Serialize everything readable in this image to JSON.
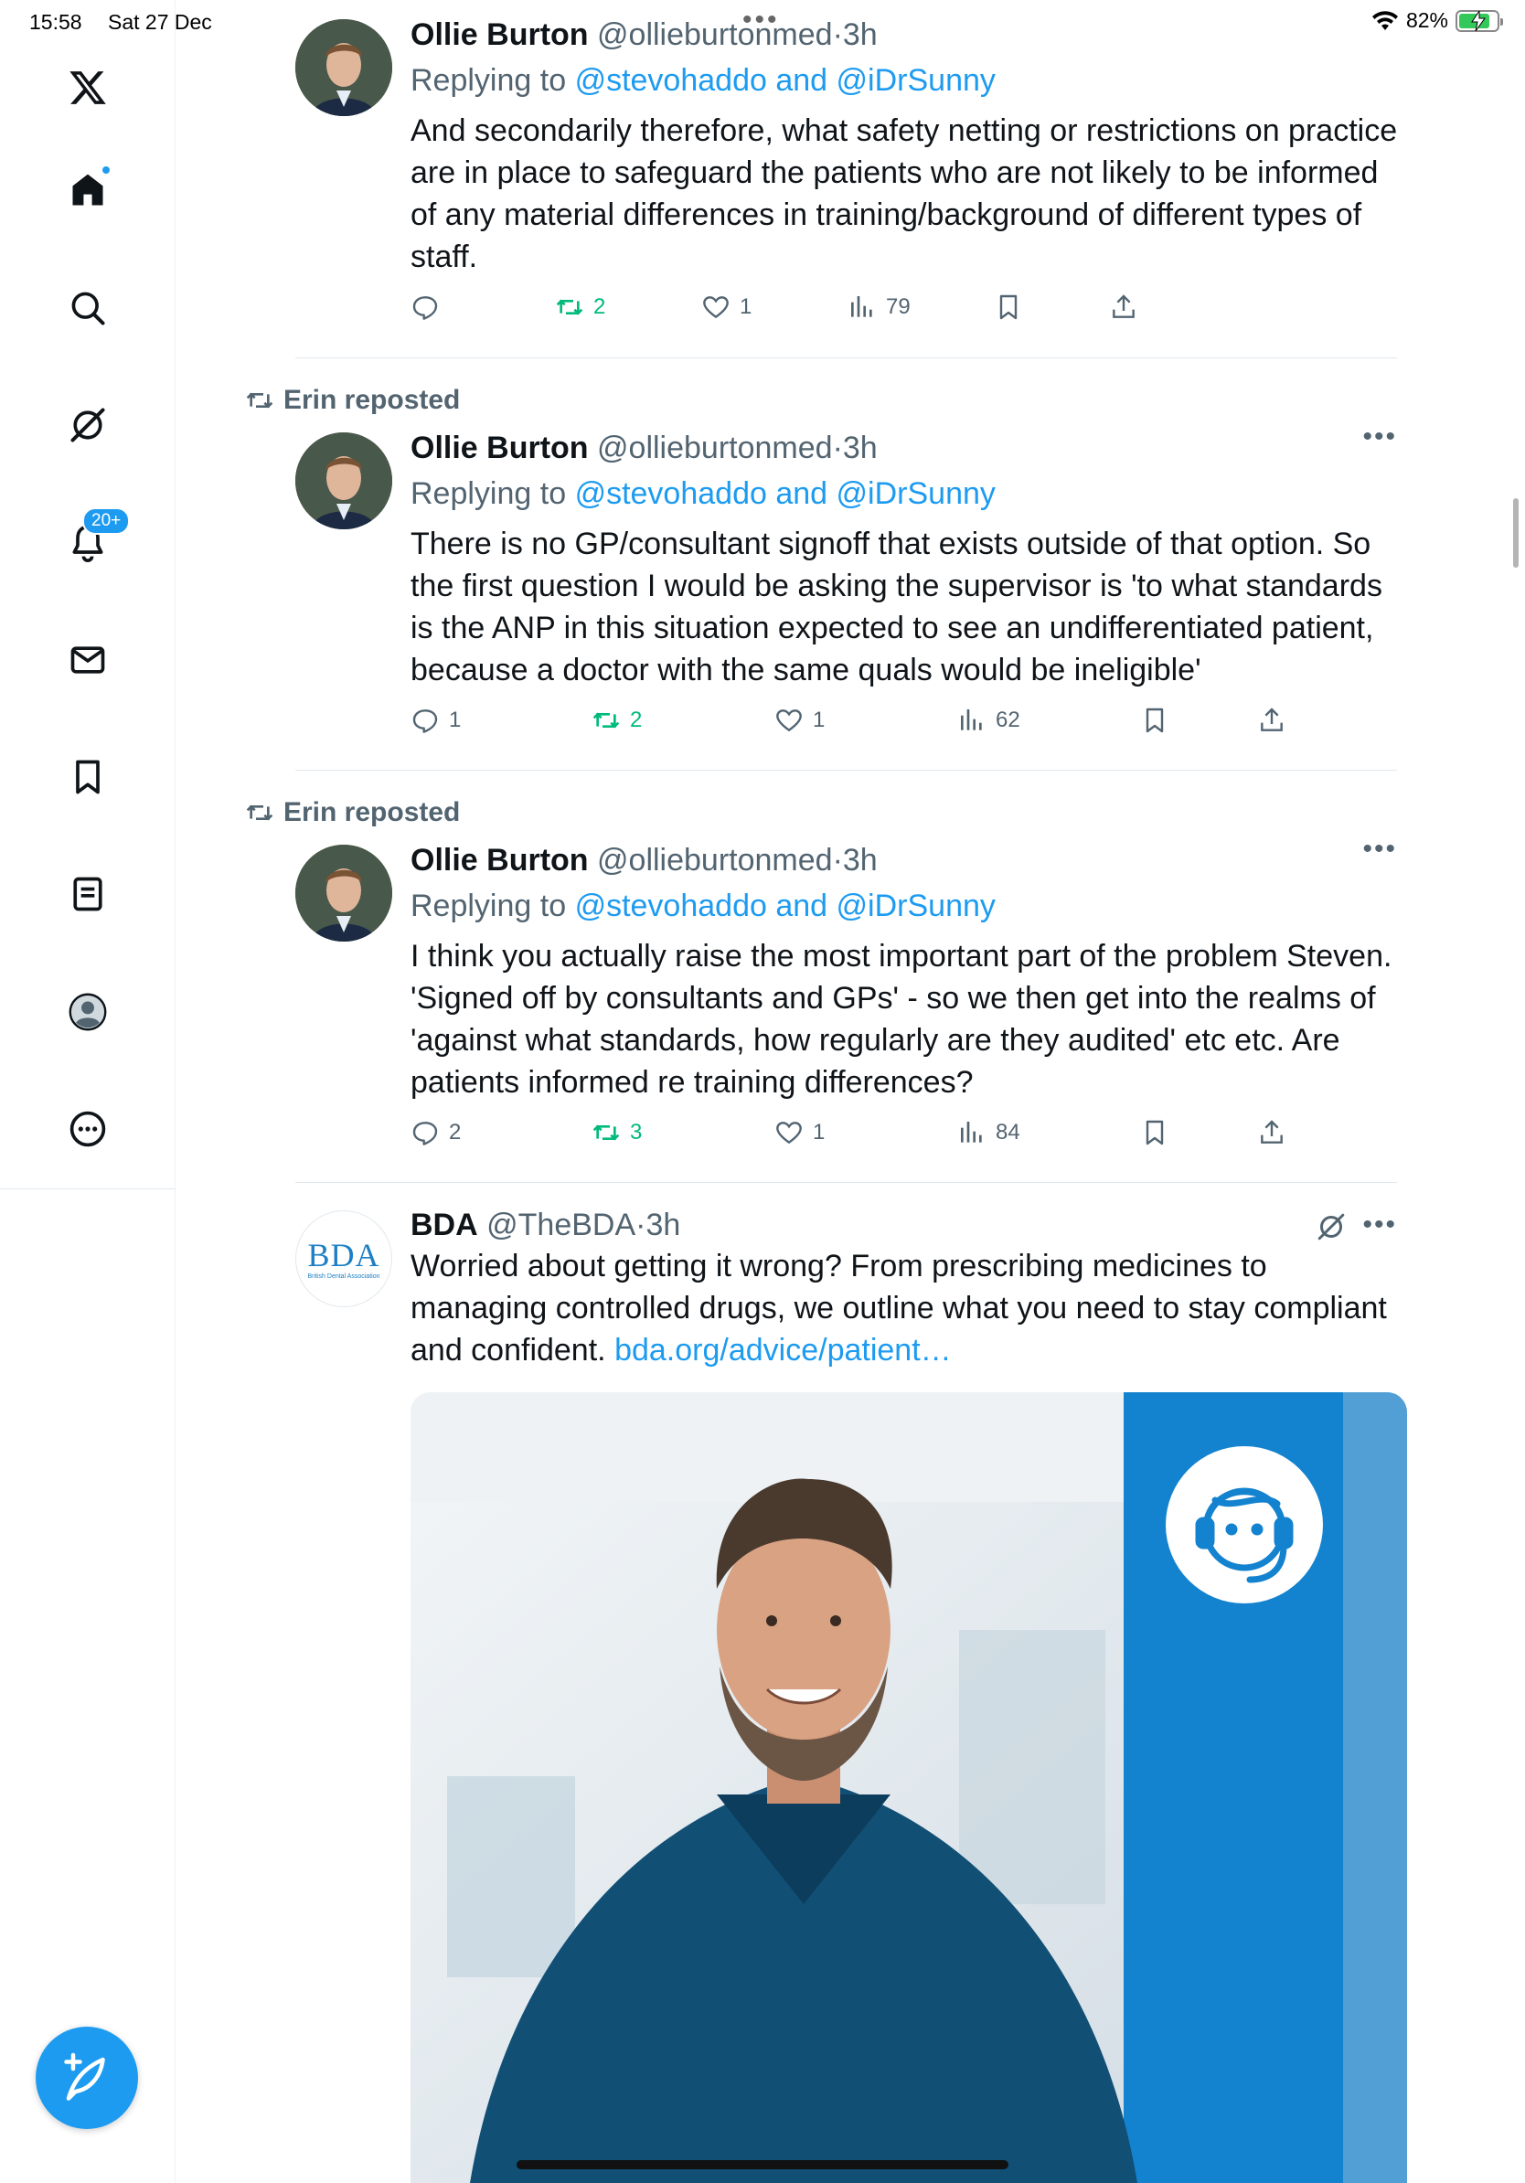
{
  "status_bar": {
    "time": "15:58",
    "date": "Sat 27 Dec",
    "battery_percent": "82%",
    "battery_level": 0.82,
    "battery_color": "#34c759"
  },
  "sidebar": {
    "items": [
      {
        "name": "x-logo-icon"
      },
      {
        "name": "home-icon",
        "active": true
      },
      {
        "name": "search-icon"
      },
      {
        "name": "grok-icon"
      },
      {
        "name": "notifications-icon",
        "badge": "20+"
      },
      {
        "name": "messages-icon"
      },
      {
        "name": "bookmarks-icon"
      },
      {
        "name": "lists-icon"
      },
      {
        "name": "profile-icon"
      },
      {
        "name": "more-icon"
      }
    ],
    "compose_icon": "compose-feather-icon"
  },
  "accent_color": "#1d9bf0",
  "retweet_color": "#00ba7c",
  "tweets": [
    {
      "display_name": "Ollie Burton",
      "handle": "@ollieburtonmed",
      "time": "3h",
      "reply_prefix": "Replying to",
      "reply_to_1": "@stevohaddo",
      "reply_and": "and",
      "reply_to_2": "@iDrSunny",
      "text": "And secondarily therefore, what safety netting or restrictions on practice are in place to safeguard the patients who are not likely to be informed of any material differences in training/background of different types of staff.",
      "replies": "",
      "retweets": "2",
      "likes": "1",
      "views": "79"
    },
    {
      "reposted_by": "Erin reposted",
      "display_name": "Ollie Burton",
      "handle": "@ollieburtonmed",
      "time": "3h",
      "reply_prefix": "Replying to",
      "reply_to_1": "@stevohaddo",
      "reply_and": "and",
      "reply_to_2": "@iDrSunny",
      "text": "There is no GP/consultant signoff that exists outside of that option. So the first question I would be asking the supervisor is 'to what standards is the ANP in this situation expected to see an undifferentiated patient, because a doctor with the same quals would be ineligible'",
      "replies": "1",
      "retweets": "2",
      "likes": "1",
      "views": "62"
    },
    {
      "reposted_by": "Erin reposted",
      "display_name": "Ollie Burton",
      "handle": "@ollieburtonmed",
      "time": "3h",
      "reply_prefix": "Replying to",
      "reply_to_1": "@stevohaddo",
      "reply_and": "and",
      "reply_to_2": "@iDrSunny",
      "text": "I think you actually raise the most important part of the problem Steven. 'Signed off by consultants and GPs' - so we then get into the realms of 'against what standards, how regularly are they audited' etc etc. Are patients informed re training differences?",
      "replies": "2",
      "retweets": "3",
      "likes": "1",
      "views": "84"
    },
    {
      "display_name": "BDA",
      "handle": "@TheBDA",
      "time": "3h",
      "text": "Worried about getting it wrong? From prescribing medicines to managing controlled drugs, we outline what you need to stay compliant and confident.",
      "link": "bda.org/advice/patient…",
      "avatar_logo": "BDA",
      "avatar_logo_sub": "British Dental Association"
    }
  ]
}
